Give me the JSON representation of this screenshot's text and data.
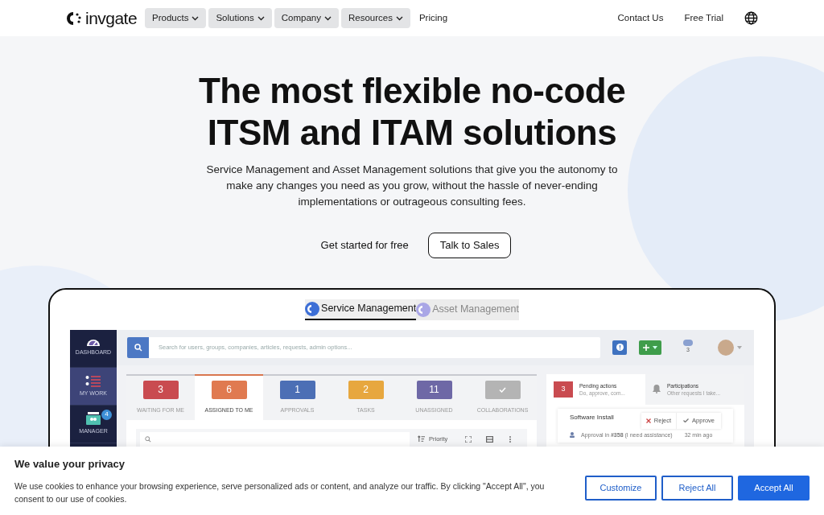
{
  "nav": {
    "logo": "invgate",
    "items": [
      {
        "label": "Products",
        "kind": "dropdown"
      },
      {
        "label": "Solutions",
        "kind": "dropdown"
      },
      {
        "label": "Company",
        "kind": "dropdown"
      },
      {
        "label": "Resources",
        "kind": "dropdown"
      },
      {
        "label": "Pricing",
        "kind": "link"
      }
    ],
    "right": [
      "Contact Us",
      "Free Trial"
    ]
  },
  "hero": {
    "title_lines": [
      "The most flexible no-code",
      "ITSM and ITAM solutions"
    ],
    "subtitle": "Service Management and Asset Management solutions that give you the autonomy to make any changes you need as you grow, without the hassle of never-ending implementations or outrageous consulting fees.",
    "primary": "Get started for free",
    "secondary": "Talk to Sales"
  },
  "showcase": {
    "tabs": [
      {
        "label": "Service Management",
        "selected": true
      },
      {
        "label": "Asset Management",
        "selected": false
      }
    ],
    "app": {
      "sidebar": [
        {
          "label": "DASHBOARD",
          "kind": "gauge",
          "selected": false
        },
        {
          "label": "MY WORK",
          "kind": "list",
          "selected": true
        },
        {
          "label": "MANAGER",
          "kind": "manager",
          "selected": false,
          "badge": "4"
        }
      ],
      "search_placeholder": "Search for users, groups, companies, articles, requests, admin options...",
      "counter": "3",
      "counters": [
        {
          "label": "WAITING FOR ME",
          "kind": "number",
          "value": "3",
          "color": "#c94b50",
          "selected": false
        },
        {
          "label": "ASSIGNED TO ME",
          "kind": "number",
          "value": "6",
          "color": "#e07a50",
          "selected": true
        },
        {
          "label": "APPROVALS",
          "kind": "number",
          "value": "1",
          "color": "#4c6fb5",
          "selected": false
        },
        {
          "label": "TASKS",
          "kind": "number",
          "value": "2",
          "color": "#e7a73f",
          "selected": false
        },
        {
          "label": "UNASSIGNED",
          "kind": "number",
          "value": "11",
          "color": "#6e68a6",
          "selected": false
        },
        {
          "label": "COLLABORATIONS",
          "kind": "check",
          "color": "#b4b4b4",
          "selected": false
        }
      ],
      "sort_label": "Priority",
      "panel_tabs": [
        {
          "title": "Pending actions",
          "subtitle": "Do, approve, com...",
          "kind": "count",
          "badge": "3",
          "selected": true
        },
        {
          "title": "Participations",
          "subtitle": "Other requests I take...",
          "kind": "bell",
          "selected": false
        }
      ],
      "request": {
        "title": "Software Install",
        "reject": "Reject",
        "approve": "Approve",
        "detail": "Approval in **#358** (I need assistance)",
        "time": "32 min ago"
      }
    }
  },
  "cookie": {
    "title": "We value your privacy",
    "text": "We use cookies to enhance your browsing experience, serve personalized ads or content, and analyze our traffic. By clicking \"Accept All\", you consent to our use of cookies.",
    "buttons": [
      {
        "label": "Customize",
        "kind": "outline"
      },
      {
        "label": "Reject All",
        "kind": "outline"
      },
      {
        "label": "Accept All",
        "kind": "primary"
      }
    ]
  }
}
